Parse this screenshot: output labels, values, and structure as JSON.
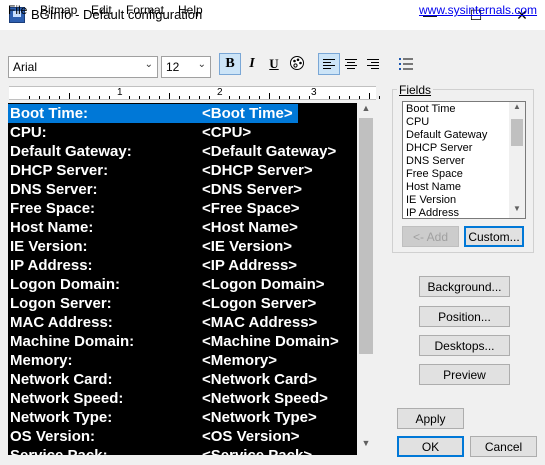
{
  "window": {
    "title": "BGInfo - Default configuration",
    "minimize": "—",
    "maximize": "☐",
    "close": "✕"
  },
  "menu": {
    "file": "File",
    "bitmap": "Bitmap",
    "edit": "Edit",
    "format": "Format",
    "help": "Help",
    "link": "www.sysinternals.com"
  },
  "toolbar": {
    "font": "Arial",
    "size": "12",
    "bold": "B",
    "italic": "I",
    "underline": "U",
    "font_color_icon": "🎨"
  },
  "ruler": {
    "numbers": [
      "1",
      "2",
      "3"
    ]
  },
  "editor": {
    "rows": [
      {
        "label": "Boot Time:",
        "value": "<Boot Time>",
        "selected": true
      },
      {
        "label": "CPU:",
        "value": "<CPU>"
      },
      {
        "label": "Default Gateway:",
        "value": "<Default Gateway>"
      },
      {
        "label": "DHCP Server:",
        "value": "<DHCP Server>"
      },
      {
        "label": "DNS Server:",
        "value": "<DNS Server>"
      },
      {
        "label": "Free Space:",
        "value": "<Free Space>"
      },
      {
        "label": "Host Name:",
        "value": "<Host Name>"
      },
      {
        "label": "IE Version:",
        "value": "<IE Version>"
      },
      {
        "label": "IP Address:",
        "value": "<IP Address>"
      },
      {
        "label": "Logon Domain:",
        "value": "<Logon Domain>"
      },
      {
        "label": "Logon Server:",
        "value": "<Logon Server>"
      },
      {
        "label": "MAC Address:",
        "value": "<MAC Address>"
      },
      {
        "label": "Machine Domain:",
        "value": "<Machine Domain>"
      },
      {
        "label": "Memory:",
        "value": "<Memory>"
      },
      {
        "label": "Network Card:",
        "value": "<Network Card>"
      },
      {
        "label": "Network Speed:",
        "value": "<Network Speed>"
      },
      {
        "label": "Network Type:",
        "value": "<Network Type>"
      },
      {
        "label": "OS Version:",
        "value": "<OS Version>"
      },
      {
        "label": "Service Pack:",
        "value": "<Service Pack>"
      }
    ]
  },
  "fields": {
    "label": "Fields",
    "items": [
      "Boot Time",
      "CPU",
      "Default Gateway",
      "DHCP Server",
      "DNS Server",
      "Free Space",
      "Host Name",
      "IE Version",
      "IP Address"
    ],
    "add_button": "<- Add",
    "custom_button": "Custom..."
  },
  "buttons": {
    "background": "Background...",
    "position": "Position...",
    "desktops": "Desktops...",
    "preview": "Preview",
    "apply": "Apply",
    "ok": "OK",
    "cancel": "Cancel"
  },
  "colors": {
    "selection": "#0078d7",
    "editor_bg": "#000000",
    "editor_text": "#ffffff",
    "link": "#0000ee"
  }
}
